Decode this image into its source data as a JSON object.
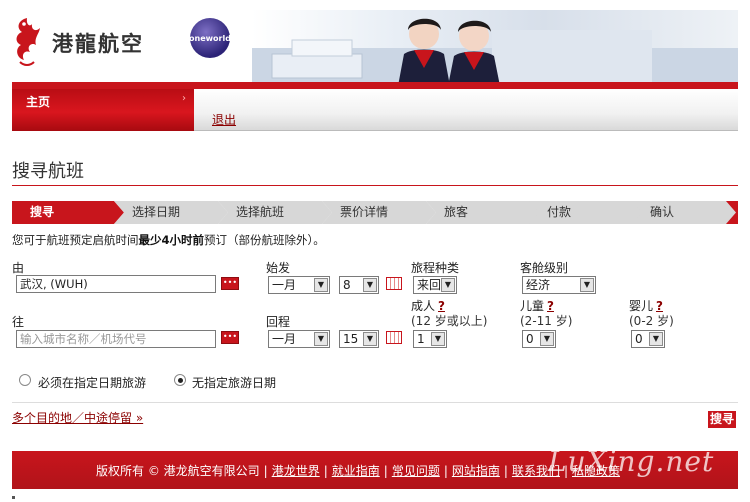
{
  "header": {
    "brand": "港龍航空",
    "alliance_logo_text": "oneworld"
  },
  "nav": {
    "home": "主页",
    "logout": "退出"
  },
  "page": {
    "title": "搜寻航班"
  },
  "steps": [
    "搜寻",
    "选择日期",
    "选择航班",
    "票价详情",
    "旅客",
    "付款",
    "确认"
  ],
  "notice": {
    "prefix": "您可于航班预定启航时间",
    "bold": "最少4小时前",
    "suffix": "预订（部份航班除外）。"
  },
  "form": {
    "origin_label": "由",
    "origin_value": "武汉, (WUH)",
    "destination_label": "往",
    "destination_placeholder": "输入城市名称／机场代号",
    "depart_label": "始发",
    "depart_month": "一月",
    "depart_day": "8",
    "return_label": "回程",
    "return_month": "一月",
    "return_day": "15",
    "trip_type_label": "旅程种类",
    "trip_type_value": "来回",
    "cabin_label": "客舱级别",
    "cabin_value": "经济",
    "adult_label": "成人",
    "adult_range": "(12 岁或以上)",
    "adult_value": "1",
    "child_label": "儿童",
    "child_range": "(2-11 岁)",
    "child_value": "0",
    "infant_label": "婴儿",
    "infant_range": "(0-2 岁)",
    "infant_value": "0",
    "help_mark": "?",
    "radio_fixed_dates": "必须在指定日期旅游",
    "radio_flexible_dates": "无指定旅游日期",
    "radio_selected": "flexible"
  },
  "actions": {
    "multi_city_link": "多个目的地／中途停留 »",
    "search_button": "搜寻"
  },
  "footer": {
    "copyright": "版权所有 © 港龙航空有限公司",
    "links": [
      "港龙世界",
      "就业指南",
      "常见问题",
      "网站指南",
      "联系我们",
      "私隐政策"
    ],
    "watermark": "LuXing.net"
  },
  "colors": {
    "brand_red": "#c8151c",
    "link_red": "#8b0000",
    "step_grey": "#d7d7d7"
  },
  "icons": {
    "origin_picker": "city-list-icon",
    "date_picker": "calendar-icon",
    "dropdown": "chevron-down-icon"
  }
}
